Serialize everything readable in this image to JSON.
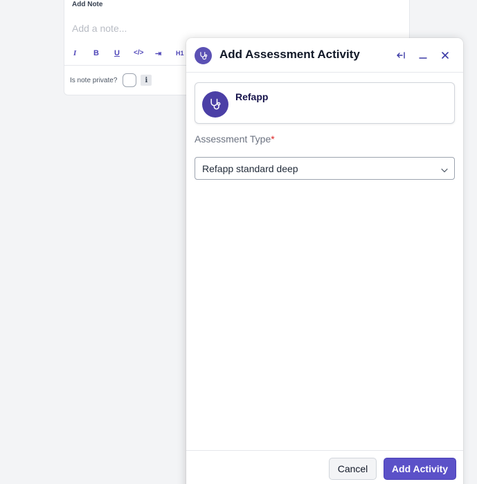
{
  "note": {
    "title": "Add Note",
    "placeholder": "Add a note...",
    "toolbar": [
      "I",
      "B",
      "U",
      "</>",
      "⇥",
      "H1"
    ],
    "private_label": "Is note private?",
    "info": "i"
  },
  "panel": {
    "title": "Add Assessment Activity",
    "entity_name": "Refapp",
    "field_label": "Assessment Type",
    "required_mark": "*",
    "selected_value": "Refapp standard deep",
    "cancel_label": "Cancel",
    "submit_label": "Add Activity"
  },
  "icons": {
    "header": "stethoscope-icon",
    "collapse": "collapse-left-icon",
    "minimize": "minimize-icon",
    "close": "close-icon"
  },
  "colors": {
    "accent": "#5b51c8",
    "icon_bg": "#4b3fa6",
    "required": "#dc2626"
  }
}
